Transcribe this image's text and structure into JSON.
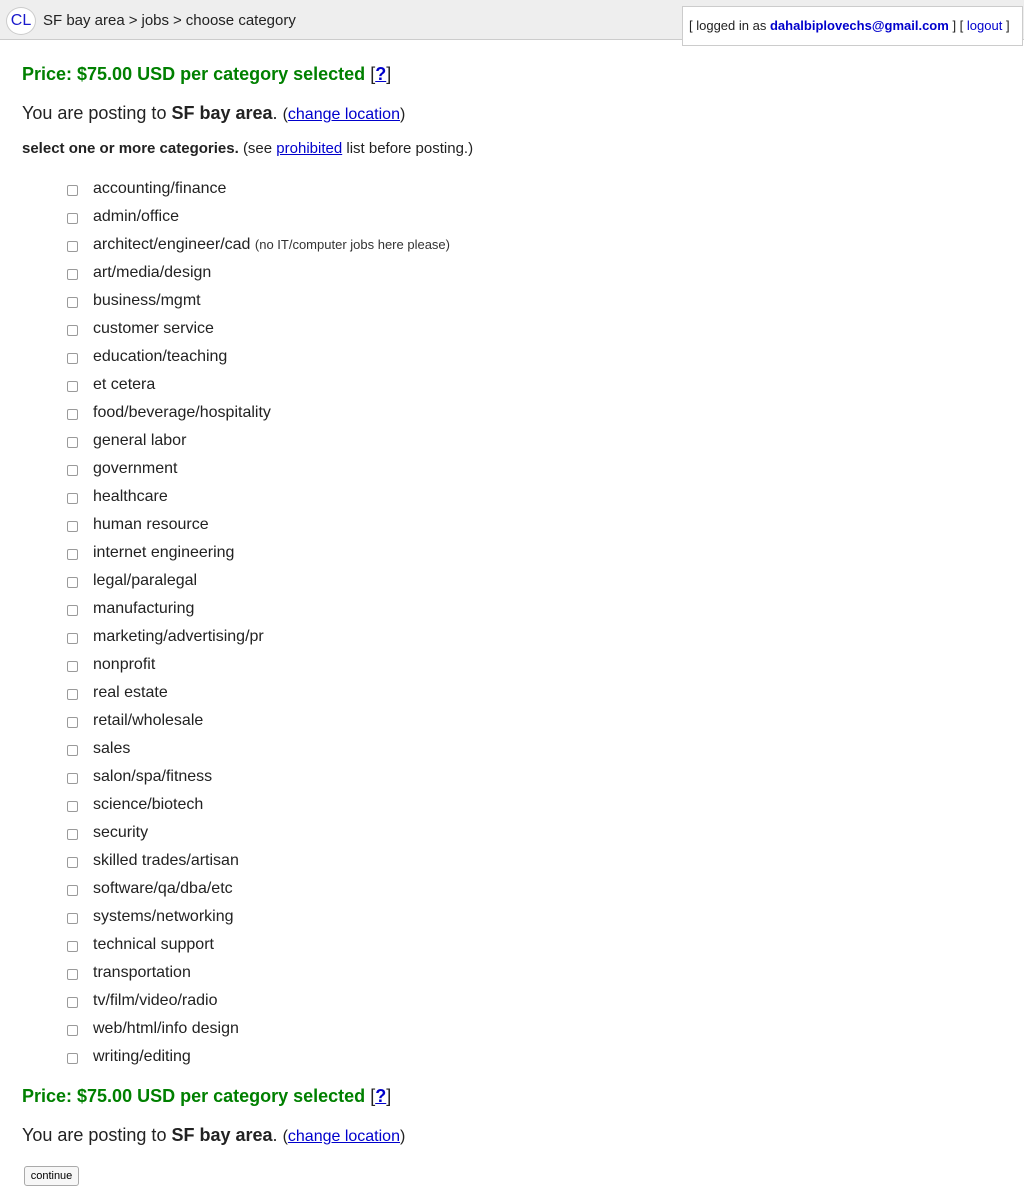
{
  "header": {
    "logo": "CL",
    "breadcrumbs": [
      "SF bay area",
      "jobs",
      "choose category"
    ],
    "separator": ">"
  },
  "user": {
    "prefix": "[ logged in as",
    "email": "dahalbiplovechs@gmail.com",
    "mid": "] [",
    "logout": "logout",
    "suffix": "]"
  },
  "price": {
    "text": "Price: $75.00 USD per category selected",
    "help_open": "[",
    "help": "?",
    "help_close": "]"
  },
  "posting": {
    "prefix": "You are posting to",
    "location": "SF bay area",
    "period": ".",
    "paren_open": "(",
    "change": "change location",
    "paren_close": ")"
  },
  "instructions": {
    "bold": "select one or more categories.",
    "see": "(see",
    "link": "prohibited",
    "after": "list before posting.)"
  },
  "categories": [
    {
      "label": "accounting/finance",
      "note": ""
    },
    {
      "label": "admin/office",
      "note": ""
    },
    {
      "label": "architect/engineer/cad",
      "note": "(no IT/computer jobs here please)"
    },
    {
      "label": "art/media/design",
      "note": ""
    },
    {
      "label": "business/mgmt",
      "note": ""
    },
    {
      "label": "customer service",
      "note": ""
    },
    {
      "label": "education/teaching",
      "note": ""
    },
    {
      "label": "et cetera",
      "note": ""
    },
    {
      "label": "food/beverage/hospitality",
      "note": ""
    },
    {
      "label": "general labor",
      "note": ""
    },
    {
      "label": "government",
      "note": ""
    },
    {
      "label": "healthcare",
      "note": ""
    },
    {
      "label": "human resource",
      "note": ""
    },
    {
      "label": "internet engineering",
      "note": ""
    },
    {
      "label": "legal/paralegal",
      "note": ""
    },
    {
      "label": "manufacturing",
      "note": ""
    },
    {
      "label": "marketing/advertising/pr",
      "note": ""
    },
    {
      "label": "nonprofit",
      "note": ""
    },
    {
      "label": "real estate",
      "note": ""
    },
    {
      "label": "retail/wholesale",
      "note": ""
    },
    {
      "label": "sales",
      "note": ""
    },
    {
      "label": "salon/spa/fitness",
      "note": ""
    },
    {
      "label": "science/biotech",
      "note": ""
    },
    {
      "label": "security",
      "note": ""
    },
    {
      "label": "skilled trades/artisan",
      "note": ""
    },
    {
      "label": "software/qa/dba/etc",
      "note": ""
    },
    {
      "label": "systems/networking",
      "note": ""
    },
    {
      "label": "technical support",
      "note": ""
    },
    {
      "label": "transportation",
      "note": ""
    },
    {
      "label": "tv/film/video/radio",
      "note": ""
    },
    {
      "label": "web/html/info design",
      "note": ""
    },
    {
      "label": "writing/editing",
      "note": ""
    }
  ],
  "continue_label": "continue"
}
